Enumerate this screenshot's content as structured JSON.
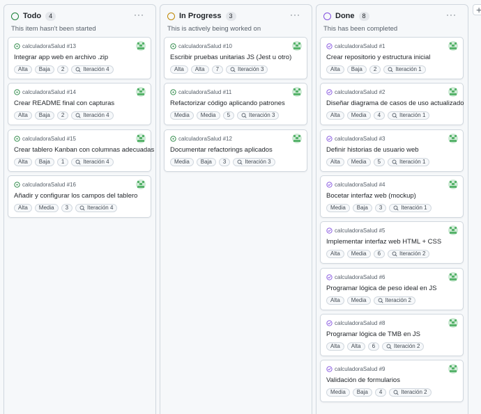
{
  "colors": {
    "todo": "#1a7f37",
    "in_progress": "#bf8700",
    "done": "#8250df"
  },
  "add_column_icon": "plus-icon",
  "columns": [
    {
      "title": "Todo",
      "count": "4",
      "description": "This item hasn't been started",
      "menu": "···",
      "cards": [
        {
          "ref": "calculadoraSalud #13",
          "title": "Integrar app web en archivo .zip",
          "labels": [
            "Alta",
            "Baja",
            "2"
          ],
          "iteration": "Iteración 4"
        },
        {
          "ref": "calculadoraSalud #14",
          "title": "Crear README final con capturas",
          "labels": [
            "Alta",
            "Baja",
            "2"
          ],
          "iteration": "Iteración 4"
        },
        {
          "ref": "calculadoraSalud #15",
          "title": "Crear tablero Kanban con columnas adecuadas",
          "labels": [
            "Alta",
            "Baja",
            "1"
          ],
          "iteration": "Iteración 4"
        },
        {
          "ref": "calculadoraSalud #16",
          "title": "Añadir y configurar los campos del tablero",
          "labels": [
            "Alta",
            "Media",
            "3"
          ],
          "iteration": "Iteración 4"
        }
      ]
    },
    {
      "title": "In Progress",
      "count": "3",
      "description": "This is actively being worked on",
      "menu": "···",
      "cards": [
        {
          "ref": "calculadoraSalud #10",
          "title": "Escribir pruebas unitarias JS (Jest u otro)",
          "labels": [
            "Alta",
            "Alta",
            "7"
          ],
          "iteration": "Iteración 3"
        },
        {
          "ref": "calculadoraSalud #11",
          "title": "Refactorizar código aplicando patrones",
          "labels": [
            "Media",
            "Media",
            "5"
          ],
          "iteration": "Iteración 3"
        },
        {
          "ref": "calculadoraSalud #12",
          "title": "Documentar refactorings aplicados",
          "labels": [
            "Media",
            "Baja",
            "3"
          ],
          "iteration": "Iteración 3"
        }
      ]
    },
    {
      "title": "Done",
      "count": "8",
      "description": "This has been completed",
      "menu": "···",
      "cards": [
        {
          "ref": "calculadoraSalud #1",
          "title": "Crear repositorio y estructura inicial",
          "labels": [
            "Alta",
            "Baja",
            "2"
          ],
          "iteration": "Iteración 1"
        },
        {
          "ref": "calculadoraSalud #2",
          "title": "Diseñar diagrama de casos de uso actualizado",
          "labels": [
            "Alta",
            "Media",
            "4"
          ],
          "iteration": "Iteración 1"
        },
        {
          "ref": "calculadoraSalud #3",
          "title": "Definir historias de usuario web",
          "labels": [
            "Alta",
            "Media",
            "5"
          ],
          "iteration": "Iteración 1"
        },
        {
          "ref": "calculadoraSalud #4",
          "title": "Bocetar interfaz web (mockup)",
          "labels": [
            "Media",
            "Baja",
            "3"
          ],
          "iteration": "Iteración 1"
        },
        {
          "ref": "calculadoraSalud #5",
          "title": "Implementar interfaz web HTML + CSS",
          "labels": [
            "Alta",
            "Media",
            "6"
          ],
          "iteration": "Iteración 2"
        },
        {
          "ref": "calculadoraSalud #6",
          "title": "Programar lógica de peso ideal en JS",
          "labels": [
            "Alta",
            "Media"
          ],
          "iteration": "Iteración 2"
        },
        {
          "ref": "calculadoraSalud #8",
          "title": "Programar lógica de TMB en JS",
          "labels": [
            "Alta",
            "Alta",
            "6"
          ],
          "iteration": "Iteración 2"
        },
        {
          "ref": "calculadoraSalud #9",
          "title": "Validación de formularios",
          "labels": [
            "Media",
            "Baja",
            "4"
          ],
          "iteration": "Iteración 2"
        }
      ]
    }
  ]
}
